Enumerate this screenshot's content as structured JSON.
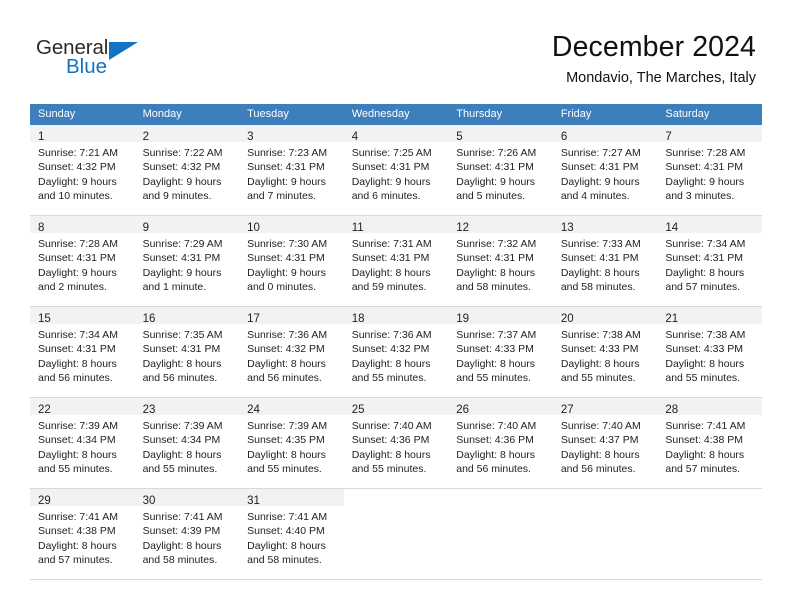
{
  "logo": {
    "word_one": "General",
    "word_two": "Blue",
    "triangle_icon": "triangle-icon",
    "brand_blue": "#1273c4",
    "brand_dark": "#2b2b2b"
  },
  "header": {
    "month_title": "December 2024",
    "location": "Mondavio, The Marches, Italy"
  },
  "theme": {
    "header_row_bg": "#3d7ebd",
    "header_row_text": "#ffffff",
    "daynum_band_bg": "#f2f2f2",
    "cell_border": "#d9d9d9",
    "body_text": "#222222"
  },
  "calendar": {
    "weekday_headers": [
      "Sunday",
      "Monday",
      "Tuesday",
      "Wednesday",
      "Thursday",
      "Friday",
      "Saturday"
    ],
    "weeks": [
      [
        {
          "day": "1",
          "sunrise": "Sunrise: 7:21 AM",
          "sunset": "Sunset: 4:32 PM",
          "daylight_line1": "Daylight: 9 hours",
          "daylight_line2": "and 10 minutes."
        },
        {
          "day": "2",
          "sunrise": "Sunrise: 7:22 AM",
          "sunset": "Sunset: 4:32 PM",
          "daylight_line1": "Daylight: 9 hours",
          "daylight_line2": "and 9 minutes."
        },
        {
          "day": "3",
          "sunrise": "Sunrise: 7:23 AM",
          "sunset": "Sunset: 4:31 PM",
          "daylight_line1": "Daylight: 9 hours",
          "daylight_line2": "and 7 minutes."
        },
        {
          "day": "4",
          "sunrise": "Sunrise: 7:25 AM",
          "sunset": "Sunset: 4:31 PM",
          "daylight_line1": "Daylight: 9 hours",
          "daylight_line2": "and 6 minutes."
        },
        {
          "day": "5",
          "sunrise": "Sunrise: 7:26 AM",
          "sunset": "Sunset: 4:31 PM",
          "daylight_line1": "Daylight: 9 hours",
          "daylight_line2": "and 5 minutes."
        },
        {
          "day": "6",
          "sunrise": "Sunrise: 7:27 AM",
          "sunset": "Sunset: 4:31 PM",
          "daylight_line1": "Daylight: 9 hours",
          "daylight_line2": "and 4 minutes."
        },
        {
          "day": "7",
          "sunrise": "Sunrise: 7:28 AM",
          "sunset": "Sunset: 4:31 PM",
          "daylight_line1": "Daylight: 9 hours",
          "daylight_line2": "and 3 minutes."
        }
      ],
      [
        {
          "day": "8",
          "sunrise": "Sunrise: 7:28 AM",
          "sunset": "Sunset: 4:31 PM",
          "daylight_line1": "Daylight: 9 hours",
          "daylight_line2": "and 2 minutes."
        },
        {
          "day": "9",
          "sunrise": "Sunrise: 7:29 AM",
          "sunset": "Sunset: 4:31 PM",
          "daylight_line1": "Daylight: 9 hours",
          "daylight_line2": "and 1 minute."
        },
        {
          "day": "10",
          "sunrise": "Sunrise: 7:30 AM",
          "sunset": "Sunset: 4:31 PM",
          "daylight_line1": "Daylight: 9 hours",
          "daylight_line2": "and 0 minutes."
        },
        {
          "day": "11",
          "sunrise": "Sunrise: 7:31 AM",
          "sunset": "Sunset: 4:31 PM",
          "daylight_line1": "Daylight: 8 hours",
          "daylight_line2": "and 59 minutes."
        },
        {
          "day": "12",
          "sunrise": "Sunrise: 7:32 AM",
          "sunset": "Sunset: 4:31 PM",
          "daylight_line1": "Daylight: 8 hours",
          "daylight_line2": "and 58 minutes."
        },
        {
          "day": "13",
          "sunrise": "Sunrise: 7:33 AM",
          "sunset": "Sunset: 4:31 PM",
          "daylight_line1": "Daylight: 8 hours",
          "daylight_line2": "and 58 minutes."
        },
        {
          "day": "14",
          "sunrise": "Sunrise: 7:34 AM",
          "sunset": "Sunset: 4:31 PM",
          "daylight_line1": "Daylight: 8 hours",
          "daylight_line2": "and 57 minutes."
        }
      ],
      [
        {
          "day": "15",
          "sunrise": "Sunrise: 7:34 AM",
          "sunset": "Sunset: 4:31 PM",
          "daylight_line1": "Daylight: 8 hours",
          "daylight_line2": "and 56 minutes."
        },
        {
          "day": "16",
          "sunrise": "Sunrise: 7:35 AM",
          "sunset": "Sunset: 4:31 PM",
          "daylight_line1": "Daylight: 8 hours",
          "daylight_line2": "and 56 minutes."
        },
        {
          "day": "17",
          "sunrise": "Sunrise: 7:36 AM",
          "sunset": "Sunset: 4:32 PM",
          "daylight_line1": "Daylight: 8 hours",
          "daylight_line2": "and 56 minutes."
        },
        {
          "day": "18",
          "sunrise": "Sunrise: 7:36 AM",
          "sunset": "Sunset: 4:32 PM",
          "daylight_line1": "Daylight: 8 hours",
          "daylight_line2": "and 55 minutes."
        },
        {
          "day": "19",
          "sunrise": "Sunrise: 7:37 AM",
          "sunset": "Sunset: 4:33 PM",
          "daylight_line1": "Daylight: 8 hours",
          "daylight_line2": "and 55 minutes."
        },
        {
          "day": "20",
          "sunrise": "Sunrise: 7:38 AM",
          "sunset": "Sunset: 4:33 PM",
          "daylight_line1": "Daylight: 8 hours",
          "daylight_line2": "and 55 minutes."
        },
        {
          "day": "21",
          "sunrise": "Sunrise: 7:38 AM",
          "sunset": "Sunset: 4:33 PM",
          "daylight_line1": "Daylight: 8 hours",
          "daylight_line2": "and 55 minutes."
        }
      ],
      [
        {
          "day": "22",
          "sunrise": "Sunrise: 7:39 AM",
          "sunset": "Sunset: 4:34 PM",
          "daylight_line1": "Daylight: 8 hours",
          "daylight_line2": "and 55 minutes."
        },
        {
          "day": "23",
          "sunrise": "Sunrise: 7:39 AM",
          "sunset": "Sunset: 4:34 PM",
          "daylight_line1": "Daylight: 8 hours",
          "daylight_line2": "and 55 minutes."
        },
        {
          "day": "24",
          "sunrise": "Sunrise: 7:39 AM",
          "sunset": "Sunset: 4:35 PM",
          "daylight_line1": "Daylight: 8 hours",
          "daylight_line2": "and 55 minutes."
        },
        {
          "day": "25",
          "sunrise": "Sunrise: 7:40 AM",
          "sunset": "Sunset: 4:36 PM",
          "daylight_line1": "Daylight: 8 hours",
          "daylight_line2": "and 55 minutes."
        },
        {
          "day": "26",
          "sunrise": "Sunrise: 7:40 AM",
          "sunset": "Sunset: 4:36 PM",
          "daylight_line1": "Daylight: 8 hours",
          "daylight_line2": "and 56 minutes."
        },
        {
          "day": "27",
          "sunrise": "Sunrise: 7:40 AM",
          "sunset": "Sunset: 4:37 PM",
          "daylight_line1": "Daylight: 8 hours",
          "daylight_line2": "and 56 minutes."
        },
        {
          "day": "28",
          "sunrise": "Sunrise: 7:41 AM",
          "sunset": "Sunset: 4:38 PM",
          "daylight_line1": "Daylight: 8 hours",
          "daylight_line2": "and 57 minutes."
        }
      ],
      [
        {
          "day": "29",
          "sunrise": "Sunrise: 7:41 AM",
          "sunset": "Sunset: 4:38 PM",
          "daylight_line1": "Daylight: 8 hours",
          "daylight_line2": "and 57 minutes."
        },
        {
          "day": "30",
          "sunrise": "Sunrise: 7:41 AM",
          "sunset": "Sunset: 4:39 PM",
          "daylight_line1": "Daylight: 8 hours",
          "daylight_line2": "and 58 minutes."
        },
        {
          "day": "31",
          "sunrise": "Sunrise: 7:41 AM",
          "sunset": "Sunset: 4:40 PM",
          "daylight_line1": "Daylight: 8 hours",
          "daylight_line2": "and 58 minutes."
        },
        {
          "day": "",
          "sunrise": "",
          "sunset": "",
          "daylight_line1": "",
          "daylight_line2": ""
        },
        {
          "day": "",
          "sunrise": "",
          "sunset": "",
          "daylight_line1": "",
          "daylight_line2": ""
        },
        {
          "day": "",
          "sunrise": "",
          "sunset": "",
          "daylight_line1": "",
          "daylight_line2": ""
        },
        {
          "day": "",
          "sunrise": "",
          "sunset": "",
          "daylight_line1": "",
          "daylight_line2": ""
        }
      ]
    ]
  }
}
